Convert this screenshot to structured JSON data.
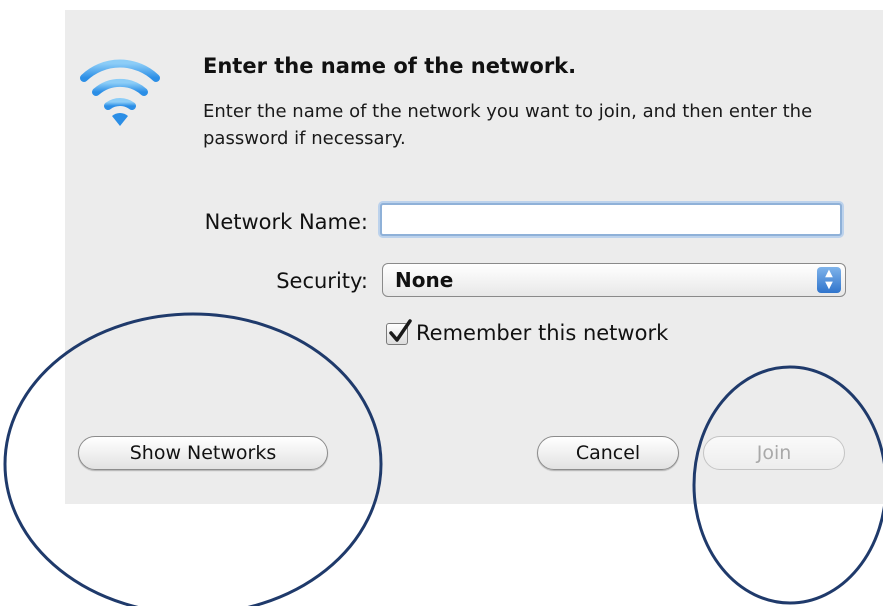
{
  "dialog": {
    "heading": "Enter the name of the network.",
    "description": "Enter the name of the network you want to join, and then enter the password if necessary."
  },
  "form": {
    "network_name_label": "Network Name:",
    "network_name_value": "",
    "security_label": "Security:",
    "security_selected": "None",
    "remember_label": "Remember this network",
    "remember_checked": true
  },
  "buttons": {
    "show_networks": "Show Networks",
    "cancel": "Cancel",
    "join": "Join",
    "join_enabled": false
  },
  "icons": {
    "wifi": "wifi-icon",
    "select_arrows": "up-down-arrows-icon",
    "checkmark": "checkmark-icon"
  },
  "colors": {
    "dialog_background": "#ececec",
    "wifi_blue": "#3f9fe8",
    "focus_ring": "#8fb1d8",
    "annotation_circle": "#1f3a6b"
  }
}
